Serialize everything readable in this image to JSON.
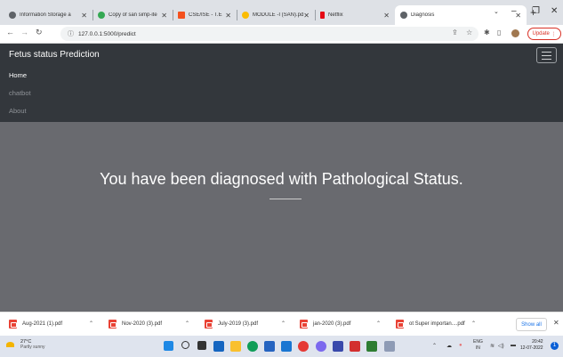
{
  "browser": {
    "tabs": [
      {
        "title": "Information Storage a",
        "icon_color": "#5f6368"
      },
      {
        "title": "Copy of san simp-ite",
        "icon_color": "#34a853"
      },
      {
        "title": "CSE/ISE - T.E",
        "icon_color": "#f4511e"
      },
      {
        "title": "MODULE -I (SAN).pd",
        "icon_color": "#fbbc04"
      },
      {
        "title": "Netflix",
        "icon_color": "#e50914"
      },
      {
        "title": "Diagnosis",
        "icon_color": "#5f6368"
      }
    ],
    "new_tab": "+",
    "url": "127.0.0.1:5000/predict",
    "update_label": "Update"
  },
  "nav": {
    "brand": "Fetus status Prediction",
    "links": [
      "Home",
      "chatbot",
      "About"
    ]
  },
  "hero": {
    "message": "You have been diagnosed with Pathological Status."
  },
  "downloads": {
    "items": [
      "Aug-2021 (1).pdf",
      "Nov-2020 (3).pdf",
      "July-2019 (3).pdf",
      "jan-2020 (3).pdf",
      "ot Super importan....pdf"
    ],
    "show_all": "Show all",
    "close": "✕"
  },
  "taskbar": {
    "temperature": "27°C",
    "weather": "Partly sunny",
    "language": "ENG",
    "region": "IN",
    "time": "20:42",
    "date": "12-07-2022",
    "notif_count": "1"
  }
}
